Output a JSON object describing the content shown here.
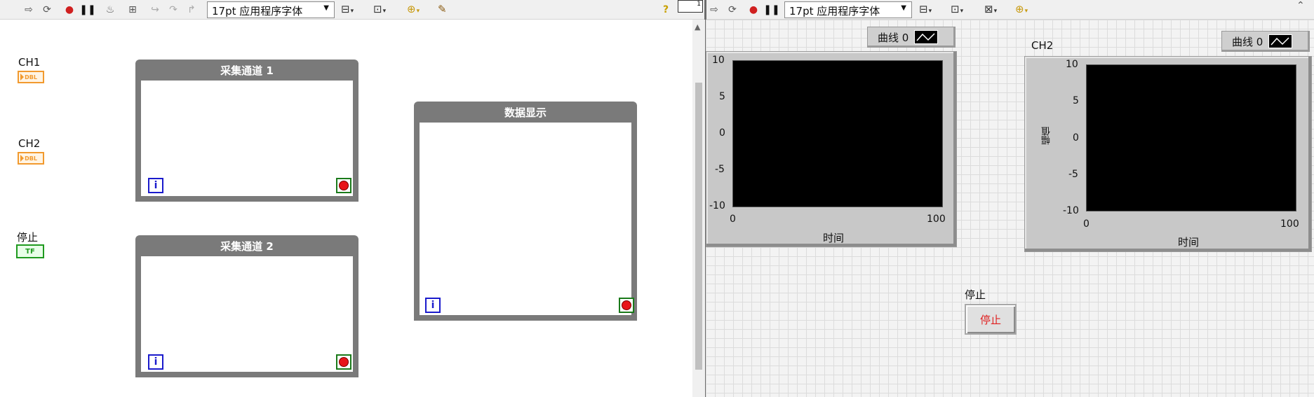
{
  "toolbar_left": {
    "font_select": "17pt 应用程序字体"
  },
  "toolbar_right": {
    "font_select": "17pt 应用程序字体",
    "vi_icon_number": "1"
  },
  "block_diagram": {
    "terminals": {
      "ch1_label": "CH1",
      "ch1_type": "DBL",
      "ch2_label": "CH2",
      "ch2_type": "DBL",
      "stop_label": "停止",
      "stop_type": "TF"
    },
    "loops": [
      {
        "title": "采集通道 1",
        "iter": "i"
      },
      {
        "title": "采集通道 2",
        "iter": "i"
      },
      {
        "title": "数据显示",
        "iter": "i"
      }
    ]
  },
  "front_panel": {
    "graph1": {
      "legend": "曲线 0",
      "xlabel": "时间",
      "y_ticks": [
        "10",
        "5",
        "0",
        "-5",
        "-10"
      ],
      "x_ticks": [
        "0",
        "100"
      ]
    },
    "graph2": {
      "title": "CH2",
      "legend": "曲线 0",
      "xlabel": "时间",
      "ylabel": "幅值",
      "y_ticks": [
        "10",
        "5",
        "0",
        "-5",
        "-10"
      ],
      "x_ticks": [
        "0",
        "100"
      ]
    },
    "stop": {
      "label": "停止",
      "button_text": "停止"
    }
  },
  "colors": {
    "loop": "#7a7a7a",
    "dbl": "#f29a2e",
    "bool": "#1f9a1f",
    "plot_bg": "#000000",
    "stop_text": "#e02020"
  }
}
